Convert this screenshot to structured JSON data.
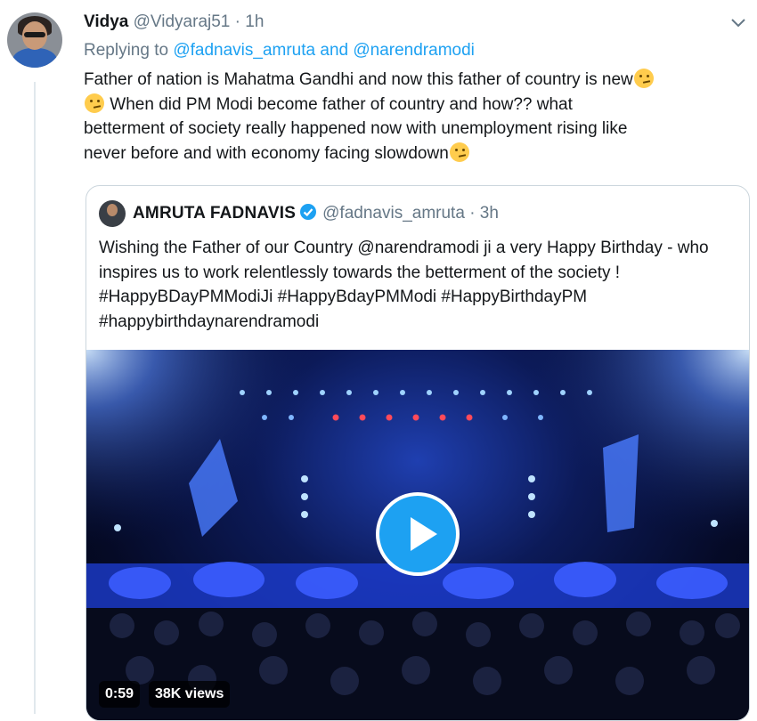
{
  "reply_tweet": {
    "display_name": "Vidya",
    "handle": "@Vidyaraj51",
    "separator": "·",
    "time": "1h",
    "replying_to_prefix": "Replying to",
    "replying_to_mentions": "@fadnavis_amruta and @narendramodi",
    "text_line_1": "Father of nation is Mahatma Gandhi and now this father of country is new",
    "text_line_2": " When did PM Modi become father of country and how?? what",
    "text_line_3": "betterment of society really happened now with unemployment rising like",
    "text_line_4": "never before and with economy facing slowdown",
    "emoji_name": "thinking-face-icon"
  },
  "quoted_tweet": {
    "display_name": "AMRUTA FADNAVIS",
    "handle": "@fadnavis_amruta",
    "separator": "·",
    "time": "3h",
    "text": "Wishing the Father of our Country @narendramodi ji a very Happy Birthday - who inspires us to work relentlessly towards the betterment of the society ! #HappyBDayPMModiJi #HappyBdayPMModi  #HappyBirthdayPM #happybirthdaynarendramodi",
    "video": {
      "duration": "0:59",
      "views": "38K views"
    }
  },
  "colors": {
    "accent": "#1da1f2",
    "muted": "#657786",
    "border": "#ccd6dd"
  }
}
